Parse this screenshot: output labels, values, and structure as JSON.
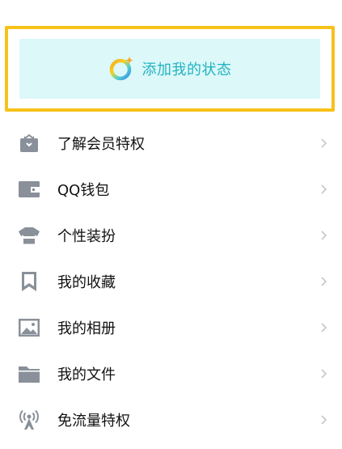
{
  "status_card": {
    "label": "添加我的状态"
  },
  "menu": {
    "items": [
      {
        "label": "了解会员特权",
        "icon": "vip-gift-icon"
      },
      {
        "label": "QQ钱包",
        "icon": "wallet-icon"
      },
      {
        "label": "个性装扮",
        "icon": "tshirt-icon"
      },
      {
        "label": "我的收藏",
        "icon": "bookmark-icon"
      },
      {
        "label": "我的相册",
        "icon": "photo-album-icon"
      },
      {
        "label": "我的文件",
        "icon": "folder-icon"
      },
      {
        "label": "免流量特权",
        "icon": "signal-tower-icon"
      }
    ]
  },
  "colors": {
    "highlight_border": "#f6c21a",
    "status_background": "#dcf8f9",
    "status_text": "#23b3c0",
    "icon_gray": "#8a9099",
    "label": "#111111",
    "chevron": "#c7c7cc"
  }
}
